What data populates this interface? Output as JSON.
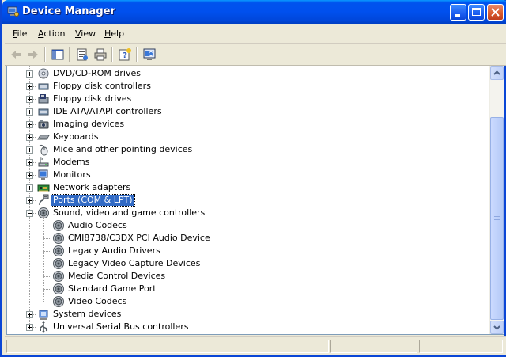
{
  "window": {
    "title": "Device Manager",
    "icon": "computer-management-icon",
    "controls": [
      "minimize-icon",
      "maximize-icon",
      "close-icon"
    ],
    "title_color": "#0050ee",
    "close_color": "#d95c2e"
  },
  "menu": {
    "items": [
      {
        "key": "F",
        "rest": "ile"
      },
      {
        "key": "A",
        "rest": "ction"
      },
      {
        "key": "V",
        "rest": "iew"
      },
      {
        "key": "H",
        "rest": "elp"
      }
    ]
  },
  "toolbar": {
    "buttons": [
      "back-icon",
      "forward-icon",
      "show-hide-tree-icon",
      "properties-icon",
      "print-icon",
      "help-icon",
      "scan-hardware-icon"
    ]
  },
  "tree": {
    "categories": [
      {
        "label": "DVD/CD-ROM drives",
        "icon": "cd-drive-icon",
        "expanded": false
      },
      {
        "label": "Floppy disk controllers",
        "icon": "controller-icon",
        "expanded": false
      },
      {
        "label": "Floppy disk drives",
        "icon": "floppy-drive-icon",
        "expanded": false
      },
      {
        "label": "IDE ATA/ATAPI controllers",
        "icon": "controller-icon",
        "expanded": false
      },
      {
        "label": "Imaging devices",
        "icon": "camera-icon",
        "expanded": false
      },
      {
        "label": "Keyboards",
        "icon": "keyboard-icon",
        "expanded": false
      },
      {
        "label": "Mice and other pointing devices",
        "icon": "mouse-icon",
        "expanded": false
      },
      {
        "label": "Modems",
        "icon": "modem-icon",
        "expanded": false
      },
      {
        "label": "Monitors",
        "icon": "monitor-icon",
        "expanded": false
      },
      {
        "label": "Network adapters",
        "icon": "network-card-icon",
        "expanded": false
      },
      {
        "label": "Ports (COM & LPT)",
        "icon": "port-icon",
        "expanded": false,
        "selected": true
      },
      {
        "label": "Sound, video and game controllers",
        "icon": "speaker-icon",
        "expanded": true,
        "children": [
          {
            "label": "Audio Codecs",
            "icon": "speaker-icon"
          },
          {
            "label": "CMI8738/C3DX PCI Audio Device",
            "icon": "speaker-icon"
          },
          {
            "label": "Legacy Audio Drivers",
            "icon": "speaker-icon"
          },
          {
            "label": "Legacy Video Capture Devices",
            "icon": "speaker-icon"
          },
          {
            "label": "Media Control Devices",
            "icon": "speaker-icon"
          },
          {
            "label": "Standard Game Port",
            "icon": "speaker-icon"
          },
          {
            "label": "Video Codecs",
            "icon": "speaker-icon"
          }
        ]
      },
      {
        "label": "System devices",
        "icon": "system-icon",
        "expanded": false
      },
      {
        "label": "Universal Serial Bus controllers",
        "icon": "usb-icon",
        "expanded": false
      }
    ],
    "selection_color": "#316ac5"
  },
  "statusbar": {
    "panes": [
      "",
      "",
      ""
    ]
  }
}
